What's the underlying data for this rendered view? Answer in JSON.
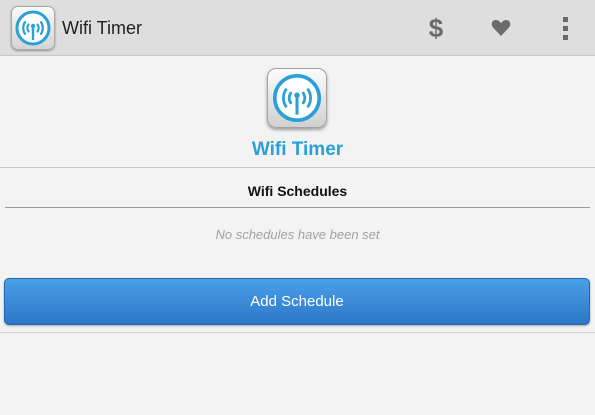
{
  "actionbar": {
    "title": "Wifi Timer",
    "app_icon": "wifi-signal-icon",
    "actions": [
      {
        "name": "donate",
        "glyph": "$",
        "icon": "dollar-icon"
      },
      {
        "name": "favorite",
        "icon": "heart-icon"
      },
      {
        "name": "overflow",
        "icon": "overflow-menu-icon"
      }
    ]
  },
  "header": {
    "title": "Wifi Timer",
    "title_color": "#2aa0d8",
    "icon": "wifi-signal-icon"
  },
  "schedules": {
    "heading": "Wifi Schedules",
    "empty_message": "No schedules have been set",
    "items": []
  },
  "add_button": {
    "label": "Add Schedule",
    "color": "#3a8bd8"
  }
}
